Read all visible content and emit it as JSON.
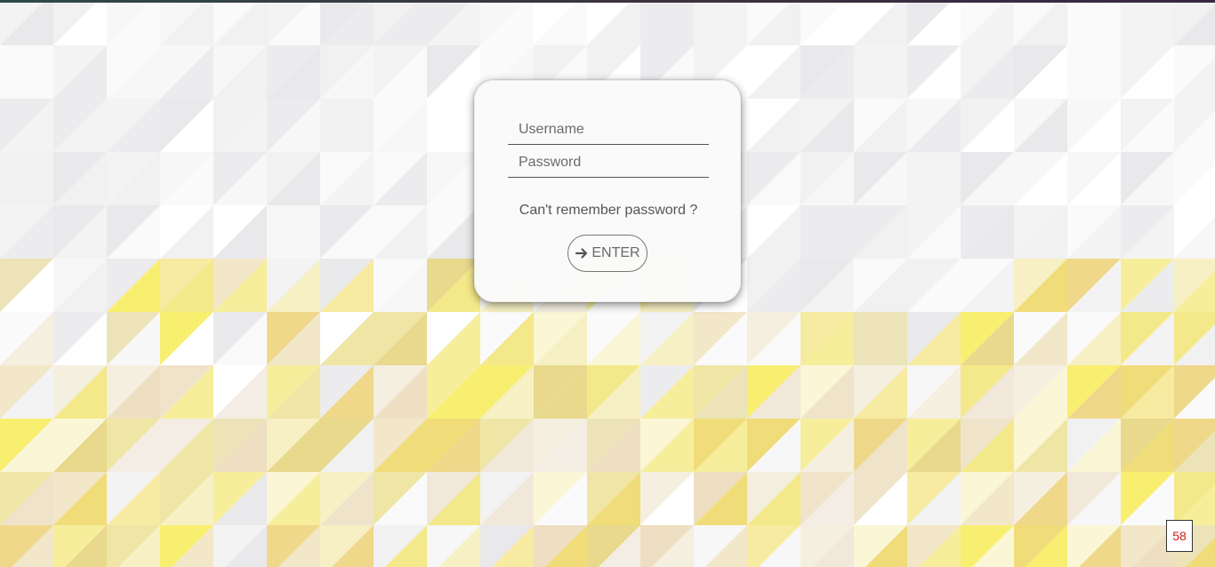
{
  "login": {
    "username_placeholder": "Username",
    "password_placeholder": "Password",
    "forgot_label": "Can't remember password ?",
    "enter_label": "ENTER",
    "enter_icon": "arrow-right-icon"
  },
  "page_badge": "58",
  "colors": {
    "card_background": "#fafafa",
    "text_muted": "#6b6b6b",
    "badge_text": "#cc1a1a",
    "pattern_light": "#f4f4f4",
    "pattern_yellow": "#f5e65a"
  }
}
